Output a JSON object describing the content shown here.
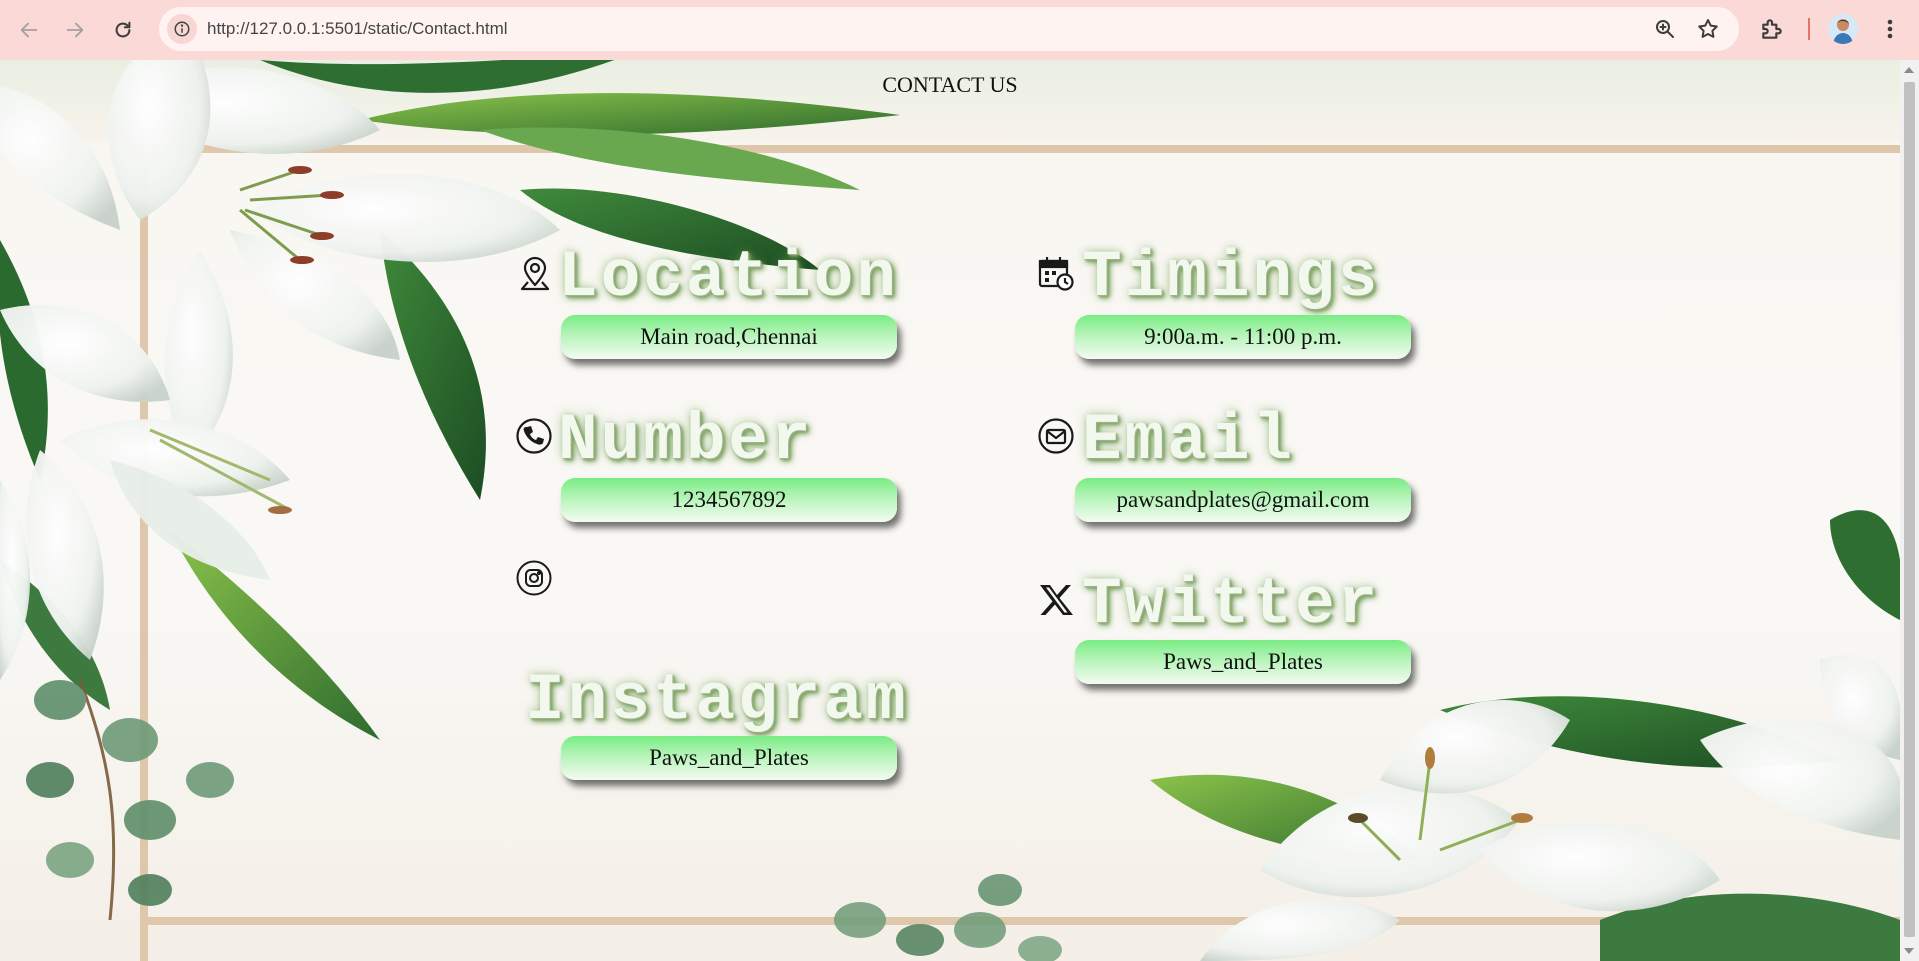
{
  "browser": {
    "url": "http://127.0.0.1:5501/static/Contact.html"
  },
  "page": {
    "title": "CONTACT US"
  },
  "contacts": {
    "location": {
      "heading": "Location",
      "value": "Main road,Chennai",
      "icon": "location-pin-icon"
    },
    "timings": {
      "heading": "Timings",
      "value": "9:00a.m. - 11:00 p.m.",
      "icon": "calendar-clock-icon"
    },
    "number": {
      "heading": "Number",
      "value": "1234567892",
      "icon": "phone-icon"
    },
    "email": {
      "heading": "Email",
      "value": "pawsandplates@gmail.com",
      "icon": "mail-icon"
    },
    "instagram": {
      "heading": "Instagram",
      "value": "Paws_and_Plates",
      "icon": "instagram-icon"
    },
    "twitter": {
      "heading": "Twitter",
      "value": "Paws_and_Plates",
      "icon": "x-logo-icon"
    }
  },
  "colors": {
    "pill_top": "#79ec84",
    "pill_bottom": "#f4fbf1",
    "chrome_bg": "#fbd9d7"
  }
}
